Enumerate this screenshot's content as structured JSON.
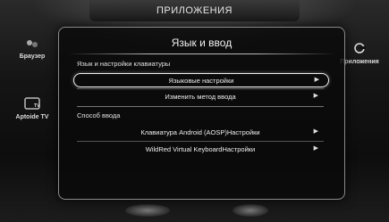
{
  "header": {
    "title": "ПРИЛОЖЕНИЯ"
  },
  "side_apps": {
    "browser": "Браузер",
    "aptoide": "Aptoide TV",
    "apps": "Приложения"
  },
  "dialog": {
    "title": "Язык и ввод",
    "section1": "Язык и настройки клавиатуры",
    "rows1": [
      {
        "label": "Языковые настройки",
        "arrow": "▶"
      },
      {
        "label": "Изменить метод ввода",
        "arrow": "▶"
      }
    ],
    "section2": "Способ ввода",
    "rows2": [
      {
        "label": "Клавиатура Android (AOSP)Настройки",
        "arrow": "▶"
      },
      {
        "label": "WildRed Virtual KeyboardНастройки",
        "arrow": "▶"
      }
    ]
  }
}
